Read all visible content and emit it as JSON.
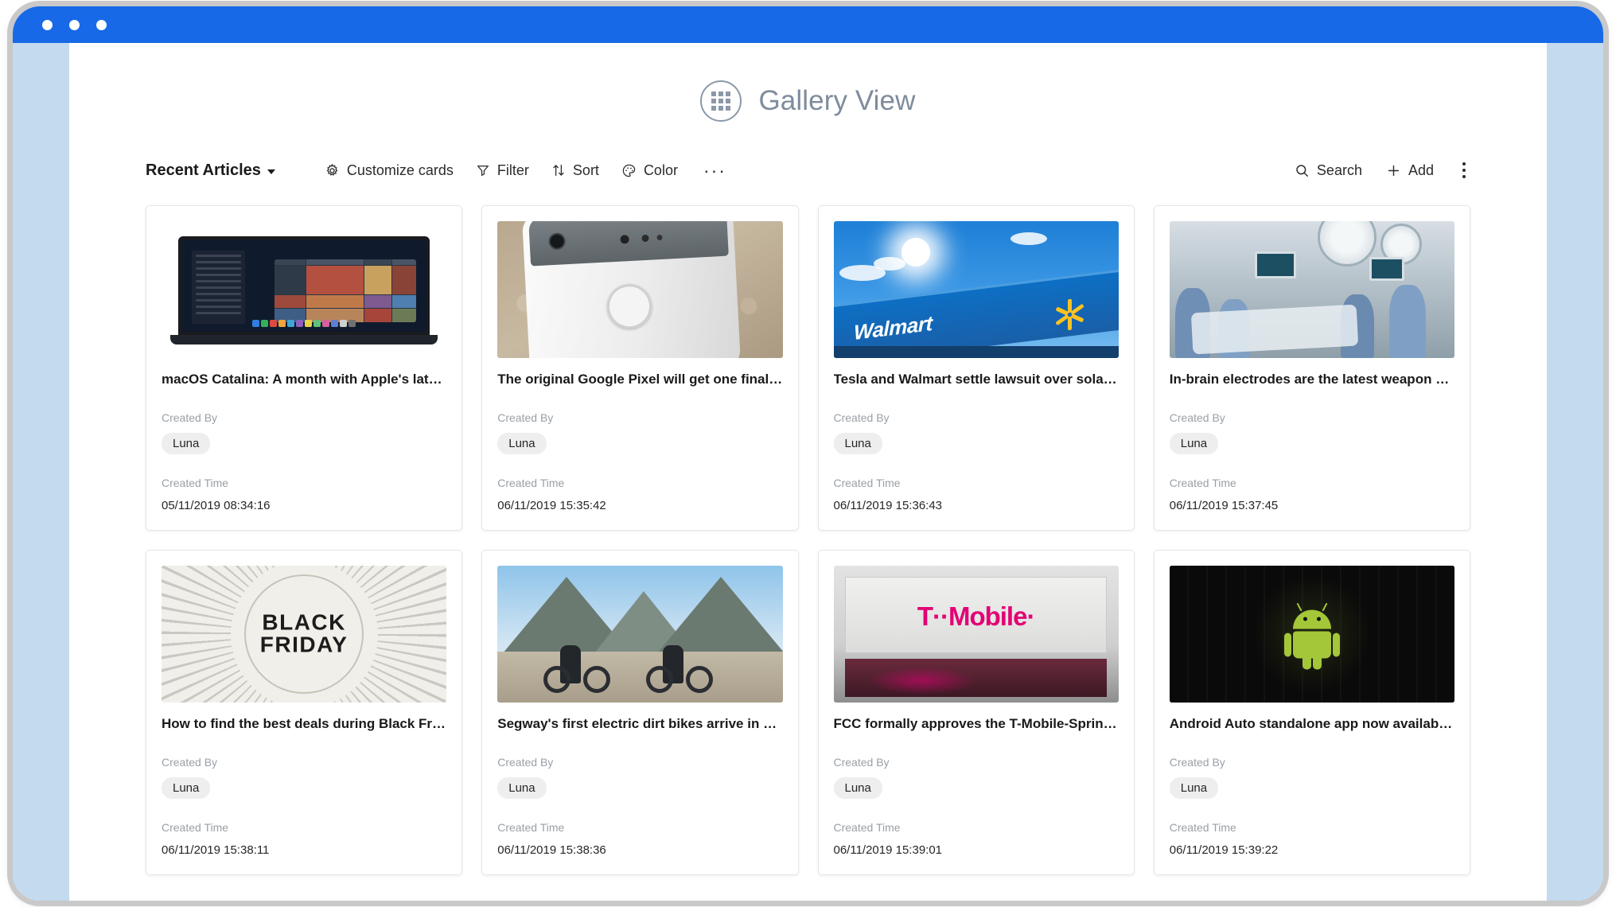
{
  "window": {
    "titlebar_color": "#1769e8",
    "rail_color": "#c3daef",
    "traffic_lights": [
      "close",
      "minimize",
      "maximize"
    ]
  },
  "header": {
    "icon": "gallery-grid-icon",
    "title": "Gallery View"
  },
  "toolbar": {
    "view_name": "Recent Articles",
    "view_caret": "chevron-down-icon",
    "actions": [
      {
        "label": "Customize cards",
        "icon": "gear-icon"
      },
      {
        "label": "Filter",
        "icon": "funnel-icon"
      },
      {
        "label": "Sort",
        "icon": "sort-arrows-icon"
      },
      {
        "label": "Color",
        "icon": "palette-icon"
      }
    ],
    "more_label": "···",
    "search_label": "Search",
    "search_icon": "search-icon",
    "add_label": "Add",
    "add_icon": "plus-icon",
    "overflow_icon": "kebab-menu-icon"
  },
  "fields": {
    "created_by_label": "Created By",
    "created_time_label": "Created Time"
  },
  "cards": [
    {
      "title": "macOS Catalina: A month with Apple's latest …",
      "created_by": "Luna",
      "created_time": "05/11/2019 08:34:16",
      "thumb": "macos-catalina-macbook"
    },
    {
      "title": "The original Google Pixel will get one final up…",
      "created_by": "Luna",
      "created_time": "06/11/2019 15:35:42",
      "thumb": "google-pixel-phone"
    },
    {
      "title": "Tesla and Walmart settle lawsuit over solar p…",
      "created_by": "Luna",
      "created_time": "06/11/2019 15:36:43",
      "thumb": "walmart-storefront"
    },
    {
      "title": "In-brain electrodes are the latest weapon agai…",
      "created_by": "Luna",
      "created_time": "06/11/2019 15:37:45",
      "thumb": "operating-room-surgery"
    },
    {
      "title": "How to find the best deals during Black Frida…",
      "created_by": "Luna",
      "created_time": "06/11/2019 15:38:11",
      "thumb": "black-friday-banner"
    },
    {
      "title": "Segway's first electric dirt bikes arrive in earl…",
      "created_by": "Luna",
      "created_time": "06/11/2019 15:38:36",
      "thumb": "segway-dirt-bikes"
    },
    {
      "title": "FCC formally approves the T-Mobile-Sprint m…",
      "created_by": "Luna",
      "created_time": "06/11/2019 15:39:01",
      "thumb": "t-mobile-store"
    },
    {
      "title": "Android Auto standalone app now available f…",
      "created_by": "Luna",
      "created_time": "06/11/2019 15:39:22",
      "thumb": "android-robot"
    }
  ],
  "thumb_art": {
    "black_friday_line1": "BLACK",
    "black_friday_line2": "FRIDAY",
    "walmart_text": "Walmart",
    "tmobile_text": "T··Mobile·"
  }
}
